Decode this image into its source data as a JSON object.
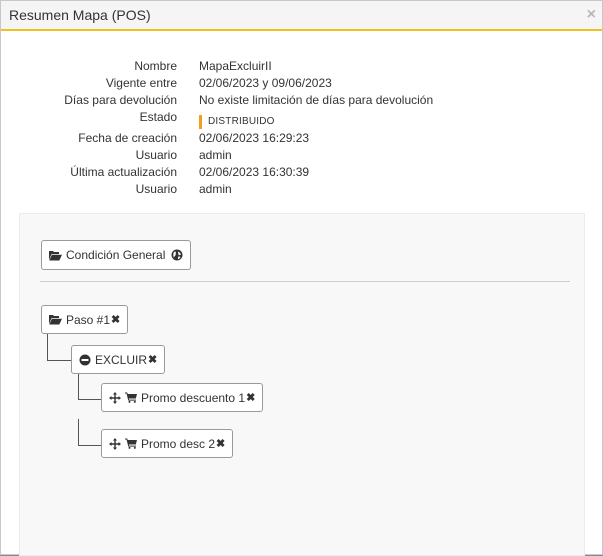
{
  "modal": {
    "title": "Resumen Mapa (POS)",
    "close_label": "×"
  },
  "info": {
    "rows": [
      {
        "label": "Nombre",
        "value": "MapaExcluirII"
      },
      {
        "label": "Vigente entre",
        "value": "02/06/2023 y 09/06/2023"
      },
      {
        "label": "Días para devolución",
        "value": "No existe limitación de días para devolución"
      },
      {
        "label": "Estado",
        "value": "DISTRIBUIDO"
      },
      {
        "label": "Fecha de creación",
        "value": "02/06/2023 16:29:23"
      },
      {
        "label": "Usuario",
        "value": "admin"
      },
      {
        "label": "Última actualización",
        "value": "02/06/2023 16:30:39"
      },
      {
        "label": "Usuario",
        "value": "admin"
      }
    ],
    "status_color": "#f0a020"
  },
  "tree": {
    "general": {
      "label": "Condición General",
      "icon": "folder-open-icon",
      "trail_icon": "globe-icon"
    },
    "step": {
      "label": "Paso #1",
      "icon": "folder-open-icon",
      "remove": "✖"
    },
    "exclude": {
      "label": "EXCLUIR",
      "icon": "minus-circle-icon",
      "remove": "✖"
    },
    "promos": [
      {
        "label": "Promo descuento 1",
        "icons": [
          "move-icon",
          "cart-icon"
        ],
        "remove": "✖"
      },
      {
        "label": "Promo desc 2",
        "icons": [
          "move-icon",
          "cart-icon"
        ],
        "remove": "✖"
      }
    ]
  },
  "colors": {
    "accent": "#f0c020",
    "header_bg": "#f5f5f5"
  }
}
